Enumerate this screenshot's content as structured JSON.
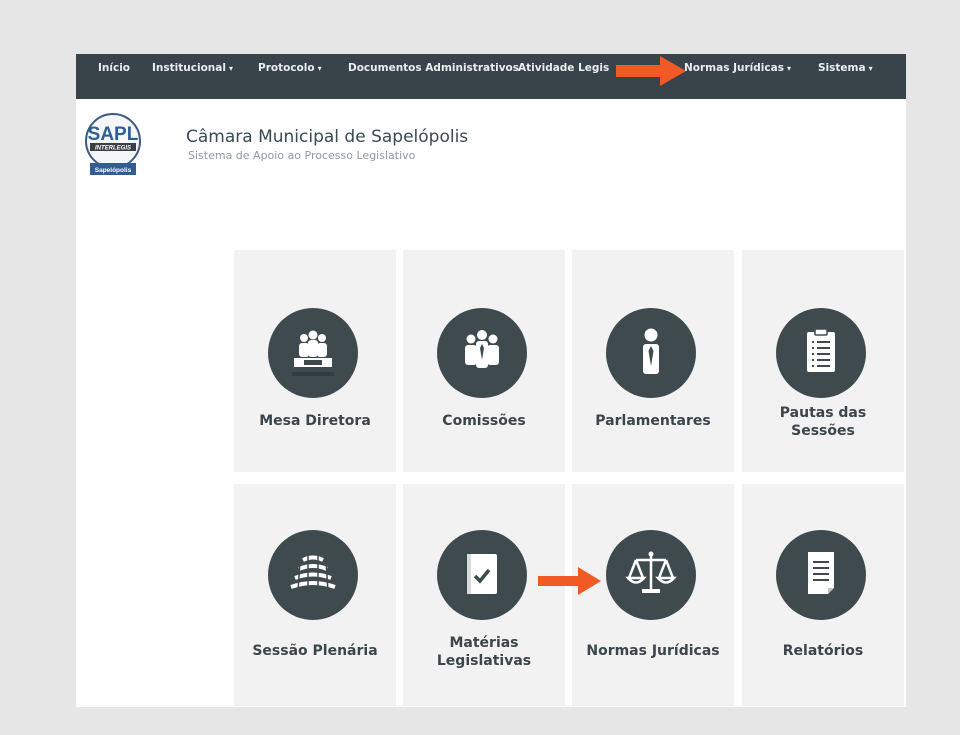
{
  "navbar": {
    "items": [
      {
        "label": "Início",
        "has_caret": false
      },
      {
        "label": "Institucional",
        "has_caret": true
      },
      {
        "label": "Protocolo",
        "has_caret": true
      },
      {
        "label": "Documentos Administrativos",
        "has_caret": false
      },
      {
        "label": "Atividade Legis",
        "has_caret": false
      },
      {
        "label": "Normas Jurídicas",
        "has_caret": true
      },
      {
        "label": "Sistema",
        "has_caret": true
      }
    ],
    "caret_glyph": "▾"
  },
  "header": {
    "logo_text": "SAPL",
    "logo_band_text": "INTERLEGIS",
    "logo_city_text": "Sapelópolis",
    "title": "Câmara Municipal de Sapelópolis",
    "subtitle": "Sistema de Apoio ao Processo Legislativo"
  },
  "tiles": [
    {
      "label": "Mesa Diretora",
      "icon": "meeting-table-icon"
    },
    {
      "label": "Comissões",
      "icon": "group-people-icon"
    },
    {
      "label": "Parlamentares",
      "icon": "person-tie-icon"
    },
    {
      "label": "Pautas das\nSessões",
      "label_lines": [
        "Pautas das",
        "Sessões"
      ],
      "icon": "clipboard-list-icon"
    },
    {
      "label": "Sessão Plenária",
      "icon": "plenary-seats-icon"
    },
    {
      "label": "Matérias\nLegislativas",
      "label_lines": [
        "Matérias",
        "Legislativas"
      ],
      "icon": "book-check-icon"
    },
    {
      "label": "Normas Jurídicas",
      "icon": "scales-icon"
    },
    {
      "label": "Relatórios",
      "icon": "document-icon"
    }
  ],
  "colors": {
    "navbar_bg": "#38444a",
    "tile_bg": "#f2f2f2",
    "icon_circle": "#3f4a4f",
    "annotation_arrow": "#f15a24"
  }
}
